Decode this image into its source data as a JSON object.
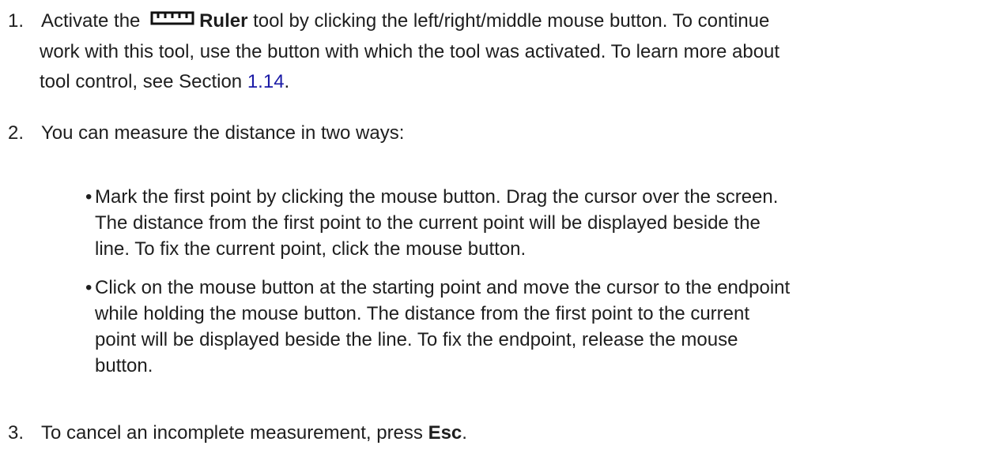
{
  "step1": {
    "number": "1.",
    "text_a": "Activate the",
    "tool_icon": "ruler-icon",
    "tool_name": "Ruler",
    "text_b": "tool by clicking the left/right/middle mouse button. To continue",
    "line2": "work with this tool, use the button with which the tool was activated. To learn more about",
    "line3_a": "tool control, see Section",
    "section_ref": "1.14",
    "line3_b": "."
  },
  "step2": {
    "number": "2.",
    "text": "You can measure the distance in two ways:",
    "bullet_symbol": "•",
    "bullets": [
      {
        "lines": [
          "Mark the first point by clicking the mouse button. Drag the cursor over the screen.",
          "The distance from the first point to the current point will be displayed beside the",
          "line. To fix the current point, click the mouse button."
        ]
      },
      {
        "lines": [
          "Click on the mouse button at the starting point and move the cursor to the endpoint",
          "while holding the mouse button. The distance from the first point to the current",
          "point will be displayed beside the line. To fix the endpoint, release the mouse",
          "button."
        ]
      }
    ]
  },
  "step3": {
    "number": "3.",
    "text_a": "To cancel an incomplete measurement, press",
    "key": "Esc",
    "text_b": "."
  },
  "colors": {
    "text": "#1e1e1e",
    "link": "#1a1aa6"
  }
}
